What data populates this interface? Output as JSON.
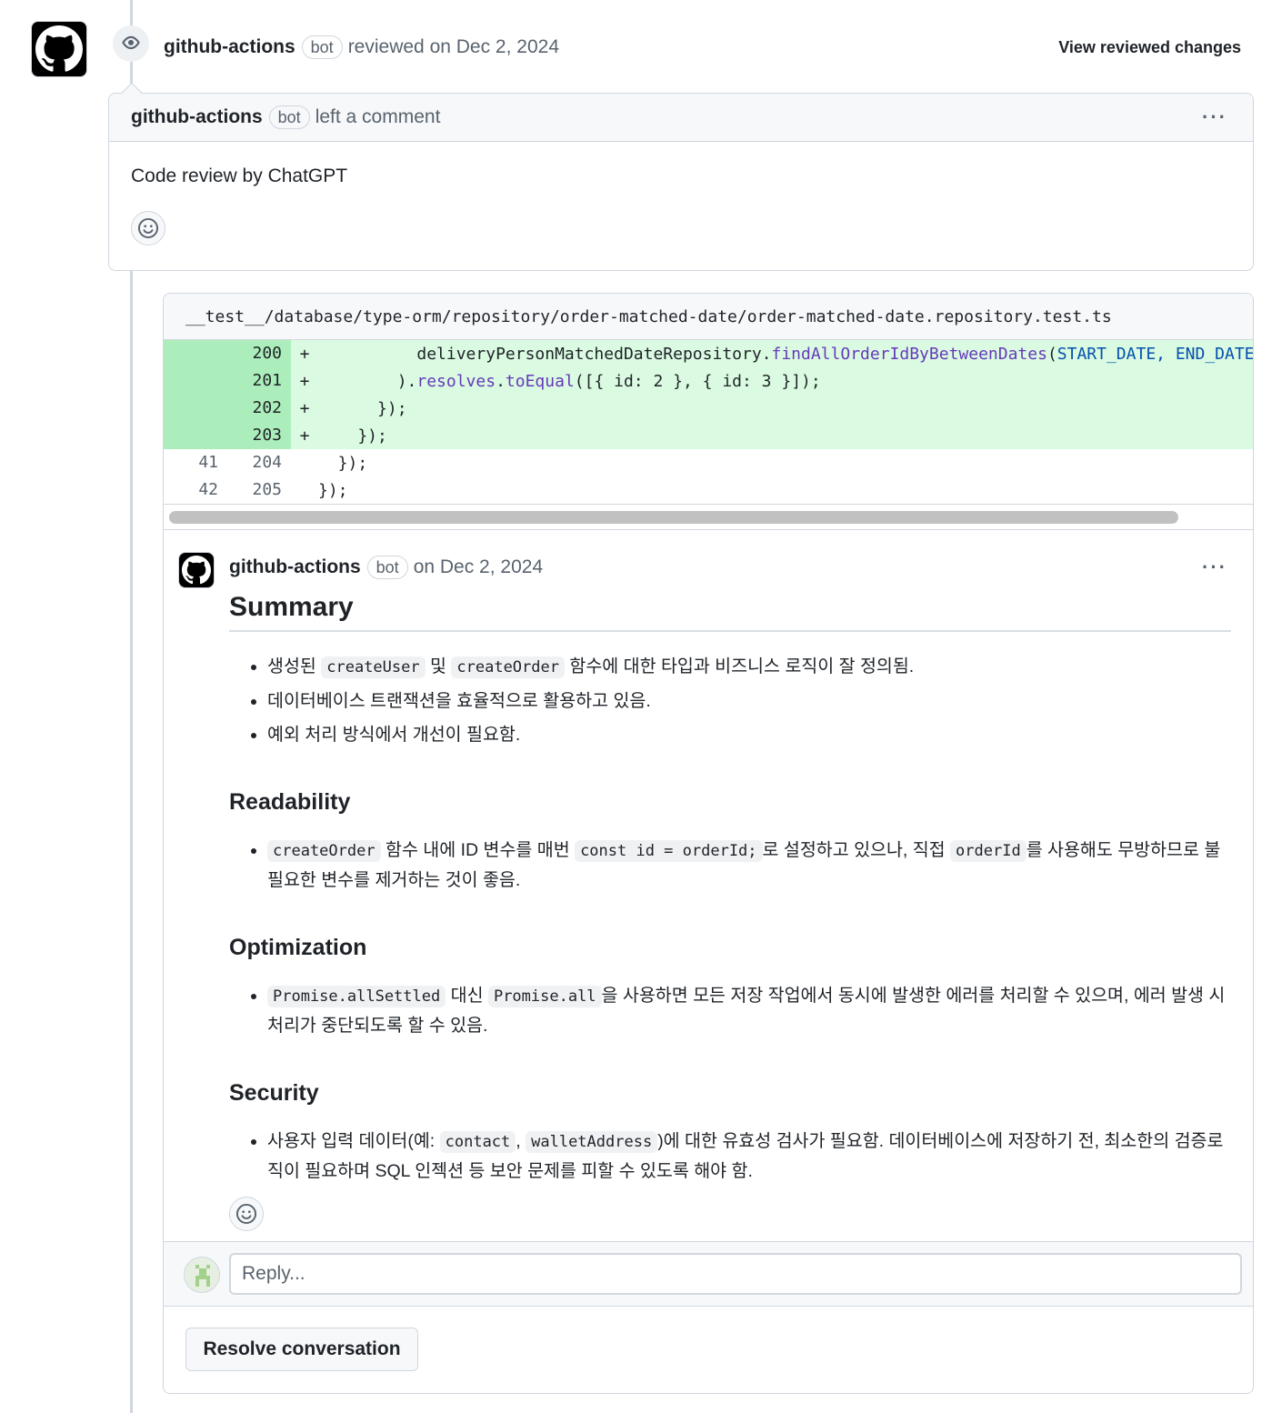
{
  "review": {
    "author": "github-actions",
    "bot_label": "bot",
    "action": "reviewed on Dec 2, 2024",
    "view_changes": "View reviewed changes"
  },
  "top_comment": {
    "author": "github-actions",
    "bot_label": "bot",
    "action": "left a comment",
    "menu": "···",
    "body": "Code review by ChatGPT"
  },
  "diff": {
    "file_path": "__test__/database/type-orm/repository/order-matched-date/order-matched-date.repository.test.ts",
    "rows": [
      {
        "old": "",
        "new": "200",
        "sign": "+",
        "type": "add",
        "code_pre": "          deliveryPersonMatchedDateRepository.",
        "code_fn": "findAllOrderIdByBetweenDates",
        "code_post": "(",
        "code_kw": "START_DATE, END_DATE",
        "code_end": ""
      },
      {
        "old": "",
        "new": "201",
        "sign": "+",
        "type": "add",
        "code_pre": "        ).",
        "code_fn": "resolves",
        "code_post": ".",
        "code_kw": "toEqual",
        "code_end": "([{ id: 2 }, { id: 3 }]);"
      },
      {
        "old": "",
        "new": "202",
        "sign": "+",
        "type": "add",
        "code_pre": "      });",
        "code_fn": "",
        "code_post": "",
        "code_kw": "",
        "code_end": ""
      },
      {
        "old": "",
        "new": "203",
        "sign": "+",
        "type": "add",
        "code_pre": "    });",
        "code_fn": "",
        "code_post": "",
        "code_kw": "",
        "code_end": ""
      },
      {
        "old": "41",
        "new": "204",
        "sign": "",
        "type": "ctx",
        "code_pre": "  });",
        "code_fn": "",
        "code_post": "",
        "code_kw": "",
        "code_end": ""
      },
      {
        "old": "42",
        "new": "205",
        "sign": "",
        "type": "ctx",
        "code_pre": "});",
        "code_fn": "",
        "code_post": "",
        "code_kw": "",
        "code_end": ""
      }
    ]
  },
  "review_comment": {
    "author": "github-actions",
    "bot_label": "bot",
    "date": "on Dec 2, 2024",
    "menu": "···",
    "summary_title": "Summary",
    "summary_items": {
      "item1": {
        "pre": "생성된 ",
        "code1": "createUser",
        "mid": " 및 ",
        "code2": "createOrder",
        "post": " 함수에 대한 타입과 비즈니스 로직이 잘 정의됨."
      },
      "item2": "데이터베이스 트랜잭션을 효율적으로 활용하고 있음.",
      "item3": "예외 처리 방식에서 개선이 필요함."
    },
    "readability_title": "Readability",
    "readability_item": {
      "code1": "createOrder",
      "mid1": " 함수 내에 ID 변수를 매번 ",
      "code2": "const id = orderId;",
      "mid2": "로 설정하고 있으나, 직접 ",
      "code3": "orderId",
      "post": "를 사용해도 무방하므로 불필요한 변수를 제거하는 것이 좋음."
    },
    "optimization_title": "Optimization",
    "optimization_item": {
      "code1": "Promise.allSettled",
      "mid": " 대신 ",
      "code2": "Promise.all",
      "post": "을 사용하면 모든 저장 작업에서 동시에 발생한 에러를 처리할 수 있으며, 에러 발생 시 처리가 중단되도록 할 수 있음."
    },
    "security_title": "Security",
    "security_item": {
      "pre": "사용자 입력 데이터(예: ",
      "code1": "contact",
      "mid": ", ",
      "code2": "walletAddress",
      "post": ")에 대한 유효성 검사가 필요함. 데이터베이스에 저장하기 전, 최소한의 검증로직이 필요하며 SQL 인젝션 등 보안 문제를 피할 수 있도록 해야 함."
    }
  },
  "reply": {
    "placeholder": "Reply..."
  },
  "resolve_button": "Resolve conversation"
}
